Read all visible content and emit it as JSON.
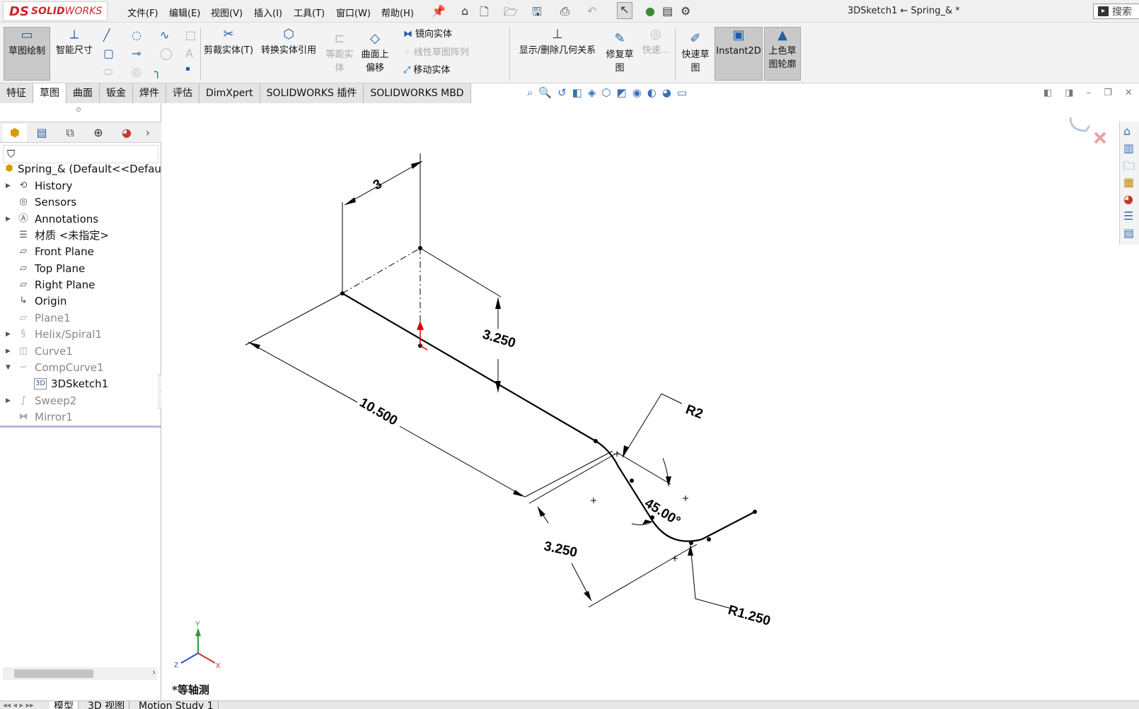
{
  "app": {
    "logo_ds": "DS",
    "logo_solid": "SOLID",
    "logo_works": "WORKS"
  },
  "menu": [
    "文件(F)",
    "编辑(E)",
    "视图(V)",
    "插入(I)",
    "工具(T)",
    "窗口(W)",
    "帮助(H)"
  ],
  "window_title": "3DSketch1 ← Spring_& *",
  "search_placeholder": "搜索",
  "toolbar": {
    "sketch": "草图绘制",
    "smart_dim": "智能尺寸",
    "trim": "剪裁实体(T)",
    "convert": "转换实体引用",
    "offset_l1": "等距实",
    "offset_l2": "体",
    "surface_l1": "曲面上",
    "surface_l2": "偏移",
    "mirror": "镜向实体",
    "linear_pattern": "线性草图阵列",
    "move": "移动实体",
    "relations": "显示/删除几何关系",
    "repair_l1": "修复草",
    "repair_l2": "图",
    "quick_snap": "快速...",
    "rapid_l1": "快速草",
    "rapid_l2": "图",
    "instant2d": "Instant2D",
    "shaded_l1": "上色草",
    "shaded_l2": "图轮廓"
  },
  "tabs": [
    "特征",
    "草图",
    "曲面",
    "钣金",
    "焊件",
    "评估",
    "DimXpert",
    "SOLIDWORKS 插件",
    "SOLIDWORKS MBD"
  ],
  "active_tab": "草图",
  "tree": [
    {
      "label": "Spring_&  (Default<<Defaul",
      "icon": "part-icon",
      "caret": "",
      "indent": 0,
      "dim": false
    },
    {
      "label": "History",
      "icon": "history-icon",
      "caret": "▶",
      "indent": 1,
      "dim": false
    },
    {
      "label": "Sensors",
      "icon": "sensors-icon",
      "caret": "",
      "indent": 1,
      "dim": false
    },
    {
      "label": "Annotations",
      "icon": "annotations-icon",
      "caret": "▶",
      "indent": 1,
      "dim": false
    },
    {
      "label": "材质 <未指定>",
      "icon": "material-icon",
      "caret": "",
      "indent": 1,
      "dim": false
    },
    {
      "label": "Front Plane",
      "icon": "plane-icon",
      "caret": "",
      "indent": 1,
      "dim": false
    },
    {
      "label": "Top Plane",
      "icon": "plane-icon",
      "caret": "",
      "indent": 1,
      "dim": false
    },
    {
      "label": "Right Plane",
      "icon": "plane-icon",
      "caret": "",
      "indent": 1,
      "dim": false
    },
    {
      "label": "Origin",
      "icon": "origin-icon",
      "caret": "",
      "indent": 1,
      "dim": false
    },
    {
      "label": "Plane1",
      "icon": "plane-icon",
      "caret": "",
      "indent": 1,
      "dim": true
    },
    {
      "label": "Helix/Spiral1",
      "icon": "helix-icon",
      "caret": "▶",
      "indent": 1,
      "dim": true
    },
    {
      "label": "Curve1",
      "icon": "curve-icon",
      "caret": "▶",
      "indent": 1,
      "dim": true
    },
    {
      "label": "CompCurve1",
      "icon": "composite-curve-icon",
      "caret": "▼",
      "indent": 1,
      "dim": true
    },
    {
      "label": "3DSketch1",
      "icon": "sketch3d-icon",
      "caret": "",
      "indent": 2,
      "dim": false
    },
    {
      "label": "Sweep2",
      "icon": "sweep-icon",
      "caret": "▶",
      "indent": 1,
      "dim": true
    },
    {
      "label": "Mirror1",
      "icon": "mirror-icon",
      "caret": "",
      "indent": 1,
      "dim": true
    }
  ],
  "dimensions": {
    "d_top": "3",
    "d_vert_upper": "3.250",
    "d_long": "10.500",
    "d_vert_lower": "3.250",
    "r_upper": "R2",
    "angle": "45.00°",
    "r_lower": "R1.250"
  },
  "triad": {
    "x": "X",
    "y": "Y",
    "z": "Z"
  },
  "view_label": "*等轴测",
  "bottom_tabs": [
    "模型",
    "3D 视图",
    "Motion Study 1"
  ],
  "colors": {
    "accent": "#1d5fa8",
    "brand": "#d2232a",
    "origin_red": "#e00000"
  }
}
